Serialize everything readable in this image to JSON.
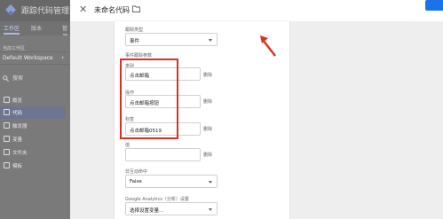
{
  "app": {
    "title": "跟踪代码管理器",
    "tabs": [
      {
        "label": "工作区",
        "active": true
      },
      {
        "label": "版本",
        "active": false
      },
      {
        "label": "管理",
        "active": false
      }
    ],
    "workspace_label": "当前工作区",
    "workspace_name": "Default Workspace",
    "search_label": "搜索",
    "nav": [
      {
        "label": "概览",
        "icon": "overview-icon",
        "active": false
      },
      {
        "label": "代码",
        "icon": "tag-icon",
        "active": true
      },
      {
        "label": "触发器",
        "icon": "trigger-icon",
        "active": false
      },
      {
        "label": "变量",
        "icon": "variable-icon",
        "active": false
      },
      {
        "label": "文件夹",
        "icon": "folder-icon",
        "active": false
      },
      {
        "label": "模板",
        "icon": "template-icon",
        "active": false
      }
    ]
  },
  "editor": {
    "tag_name": "未命名代码",
    "close_icon": "close-icon",
    "folder_icon": "folder-icon",
    "fields": {
      "track_type_label": "跟踪类型",
      "track_type_value": "事件",
      "event_params_label": "事件跟踪参数",
      "category_label": "类别",
      "category_value": "点击邮箱",
      "action_label": "操作",
      "action_value": "点击邮箱按钮",
      "label_label": "标签",
      "label_value": "点击邮箱0519",
      "value_label": "值",
      "value_value": "",
      "noninteraction_label": "非互动命中",
      "noninteraction_value": "False",
      "ga_settings_label": "Google Analytics（分析）设置",
      "ga_settings_value": "选择设置变量...",
      "delete_label": "删除"
    }
  },
  "colors": {
    "accent": "#1a73e8",
    "highlight": "#d93025"
  }
}
